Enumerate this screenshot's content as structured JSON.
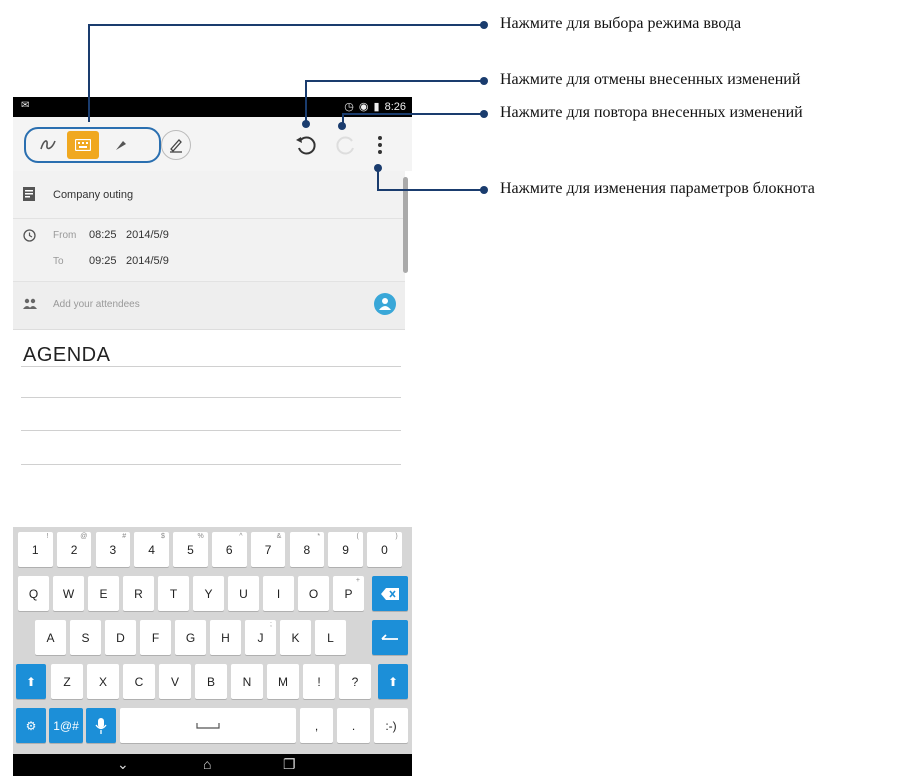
{
  "status_bar": {
    "time": "8:26",
    "left_icon": "notification-icon"
  },
  "toolbar": {
    "mode_icons": [
      "handwriting-icon",
      "keyboard-icon",
      "brush-icon"
    ],
    "pen_icon": "pen-settings-icon",
    "undo_icon": "undo-icon",
    "redo_icon": "redo-icon",
    "menu_icon": "overflow-menu-icon"
  },
  "event": {
    "title": "Company outing",
    "from_label": "From",
    "from_time": "08:25",
    "from_date": "2014/5/9",
    "to_label": "To",
    "to_time": "09:25",
    "to_date": "2014/5/9",
    "attendees_placeholder": "Add your attendees"
  },
  "note": {
    "heading": "AGENDA"
  },
  "keyboard": {
    "row1": [
      [
        "1",
        "!"
      ],
      [
        "2",
        "@"
      ],
      [
        "3",
        "#"
      ],
      [
        "4",
        "$"
      ],
      [
        "5",
        "%"
      ],
      [
        "6",
        "^"
      ],
      [
        "7",
        "&"
      ],
      [
        "8",
        "*"
      ],
      [
        "9",
        "("
      ],
      [
        "0",
        ")"
      ]
    ],
    "row2": [
      [
        "Q",
        ""
      ],
      [
        "W",
        ""
      ],
      [
        "E",
        ""
      ],
      [
        "R",
        ""
      ],
      [
        "T",
        ""
      ],
      [
        "Y",
        ""
      ],
      [
        "U",
        ""
      ],
      [
        "I",
        ""
      ],
      [
        "O",
        ""
      ],
      [
        "P",
        "+"
      ]
    ],
    "row3": [
      [
        "A",
        ""
      ],
      [
        "S",
        ""
      ],
      [
        "D",
        ""
      ],
      [
        "F",
        ""
      ],
      [
        "G",
        ""
      ],
      [
        "H",
        ""
      ],
      [
        "J",
        ";"
      ],
      [
        "K",
        ""
      ],
      [
        "L",
        ""
      ]
    ],
    "row4": [
      [
        "Z",
        ""
      ],
      [
        "X",
        ""
      ],
      [
        "C",
        ""
      ],
      [
        "V",
        ""
      ],
      [
        "B",
        ""
      ],
      [
        "N",
        ""
      ],
      [
        "M",
        ""
      ],
      [
        "!",
        ""
      ],
      [
        "?",
        ""
      ]
    ],
    "symbols_label": "1@#",
    "smiley_label": ":-)",
    "comma": ",",
    "period": "."
  },
  "annotations": {
    "input_mode": "Нажмите для выбора режима ввода",
    "undo": "Нажмите для отмены внесенных изменений",
    "redo": "Нажмите для повтора внесенных изменений",
    "settings": "Нажмите для изменения параметров блокнота"
  },
  "colors": {
    "accent_blue": "#1c8fd8",
    "mode_highlight": "#f0a820",
    "annotation_line": "#1a3c6e"
  }
}
